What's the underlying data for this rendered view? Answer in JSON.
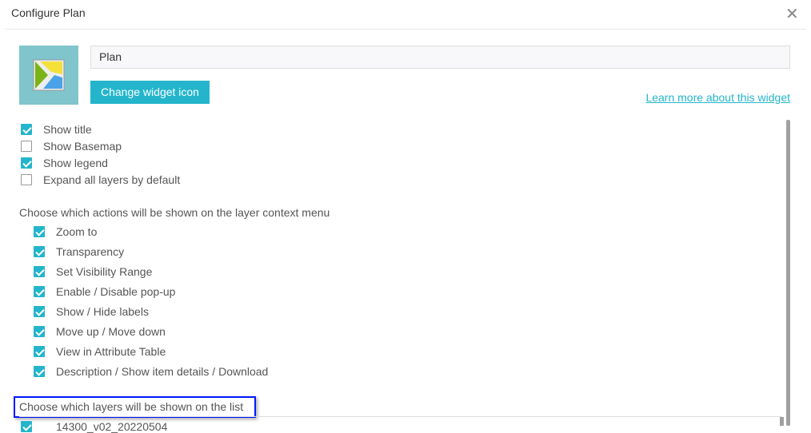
{
  "dialog": {
    "title": "Configure Plan",
    "close_icon": "close-icon"
  },
  "widget": {
    "name": "Plan",
    "change_icon_label": "Change widget icon",
    "learn_more": "Learn more about this widget"
  },
  "options": [
    {
      "label": "Show title",
      "checked": true
    },
    {
      "label": "Show Basemap",
      "checked": false
    },
    {
      "label": "Show legend",
      "checked": true
    },
    {
      "label": "Expand all layers by default",
      "checked": false
    }
  ],
  "actions_heading": "Choose which actions will be shown on the layer context menu",
  "actions": [
    {
      "label": "Zoom to",
      "checked": true
    },
    {
      "label": "Transparency",
      "checked": true
    },
    {
      "label": "Set Visibility Range",
      "checked": true
    },
    {
      "label": "Enable / Disable pop-up",
      "checked": true
    },
    {
      "label": "Show / Hide labels",
      "checked": true
    },
    {
      "label": "Move up / Move down",
      "checked": true
    },
    {
      "label": "View in Attribute Table",
      "checked": true
    },
    {
      "label": "Description / Show item details / Download",
      "checked": true
    }
  ],
  "layers_heading": "Choose which layers will be shown on the list",
  "layers": [
    {
      "label": "14300_v02_20220504",
      "checked": true
    }
  ]
}
